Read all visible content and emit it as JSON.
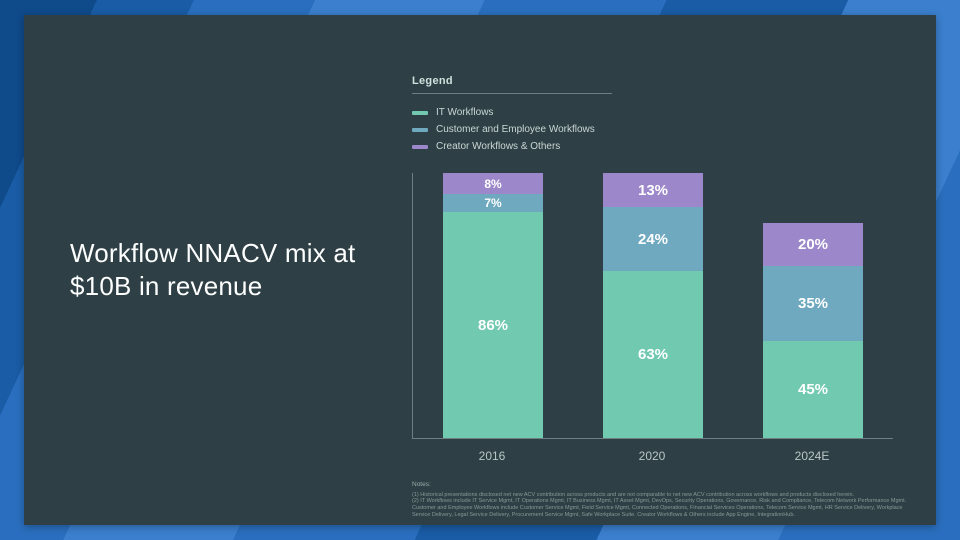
{
  "title": "Workflow NNACV mix at $10B in revenue",
  "legend": {
    "heading": "Legend",
    "items": [
      {
        "key": "it",
        "label": "IT Workflows",
        "color": "#71c9b0"
      },
      {
        "key": "ce",
        "label": "Customer and Employee Workflows",
        "color": "#6ea9bf"
      },
      {
        "key": "cr",
        "label": "Creator Workflows & Others",
        "color": "#9b87c9"
      }
    ]
  },
  "chart_data": {
    "type": "bar",
    "stacked": true,
    "unit": "percent",
    "ylim": [
      0,
      100
    ],
    "categories": [
      "2016",
      "2020",
      "2024E"
    ],
    "series": [
      {
        "key": "it",
        "name": "IT Workflows",
        "values": [
          86,
          63,
          45
        ]
      },
      {
        "key": "ce",
        "name": "Customer and Employee Workflows",
        "values": [
          7,
          24,
          35
        ]
      },
      {
        "key": "cr",
        "name": "Creator Workflows & Others",
        "values": [
          8,
          13,
          20
        ]
      }
    ],
    "bar_heights_pct_of_axis": [
      100,
      100,
      81
    ],
    "value_labels": {
      "2016": {
        "it": "86%",
        "ce": "7%",
        "cr": "8%"
      },
      "2020": {
        "it": "63%",
        "ce": "24%",
        "cr": "13%"
      },
      "2024E": {
        "it": "45%",
        "ce": "35%",
        "cr": "20%"
      }
    }
  },
  "notes": {
    "heading": "Notes:",
    "lines": [
      "(1) Historical presentations disclosed net new ACV contribution across products and are not comparable to net new ACV contribution across workflows and products disclosed herein.",
      "(2) IT Workflows include IT Service Mgmt, IT Operations Mgmt, IT Business Mgmt, IT Asset Mgmt, DevOps, Security Operations, Governance, Risk and Compliance, Telecom Network Performance Mgmt. Customer and Employee Workflows include Customer Service Mgmt, Field Service Mgmt, Connected Operations, Financial Services Operations, Telecom Service Mgmt, HR Service Delivery, Workplace Service Delivery, Legal Service Delivery, Procurement Service Mgmt, Safe Workplace Suite. Creator Workflows & Others include App Engine, IntegrationHub."
    ]
  }
}
